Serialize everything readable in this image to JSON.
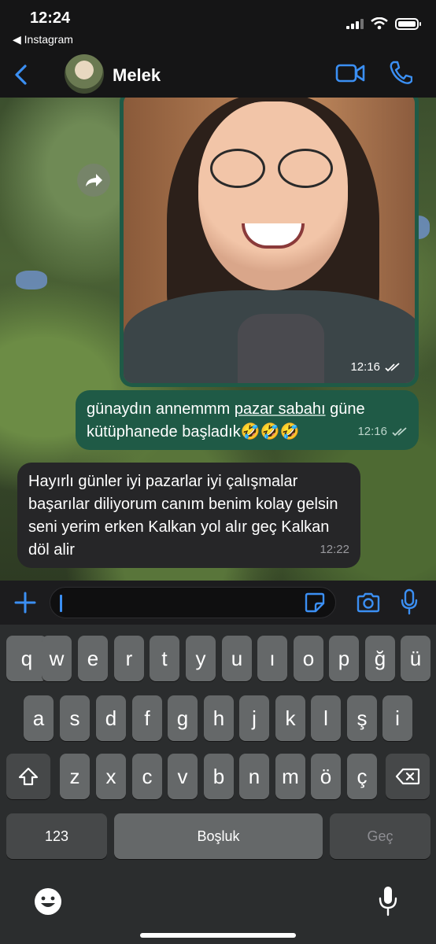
{
  "status_bar": {
    "time": "12:24",
    "back_app": "◀ Instagram"
  },
  "header": {
    "contact_name": "Melek"
  },
  "messages": {
    "photo_time": "12:16",
    "outgoing": {
      "text_a": "günaydın annemmm ",
      "text_u": "pazar sabahı",
      "text_b": " güne kütüphanede başladık🤣🤣🤣",
      "time": "12:16"
    },
    "incoming": {
      "text": "Hayırlı günler iyi pazarlar iyi çalışmalar başarılar diliyorum canım benim kolay gelsin seni yerim erken Kalkan yol alır geç Kalkan döl alir",
      "time": "12:22"
    }
  },
  "composer": {
    "value": ""
  },
  "keyboard": {
    "row1": [
      "q",
      "w",
      "e",
      "r",
      "t",
      "y",
      "u",
      "ı",
      "o",
      "p",
      "ğ",
      "ü"
    ],
    "row2": [
      "a",
      "s",
      "d",
      "f",
      "g",
      "h",
      "j",
      "k",
      "l",
      "ş",
      "i"
    ],
    "row3": [
      "z",
      "x",
      "c",
      "v",
      "b",
      "n",
      "m",
      "ö",
      "ç"
    ],
    "numbers_label": "123",
    "space_label": "Boşluk",
    "return_label": "Geç"
  },
  "colors": {
    "accent": "#3b8ff3",
    "outgoing_bubble": "#1f5a46",
    "incoming_bubble": "#262628"
  }
}
